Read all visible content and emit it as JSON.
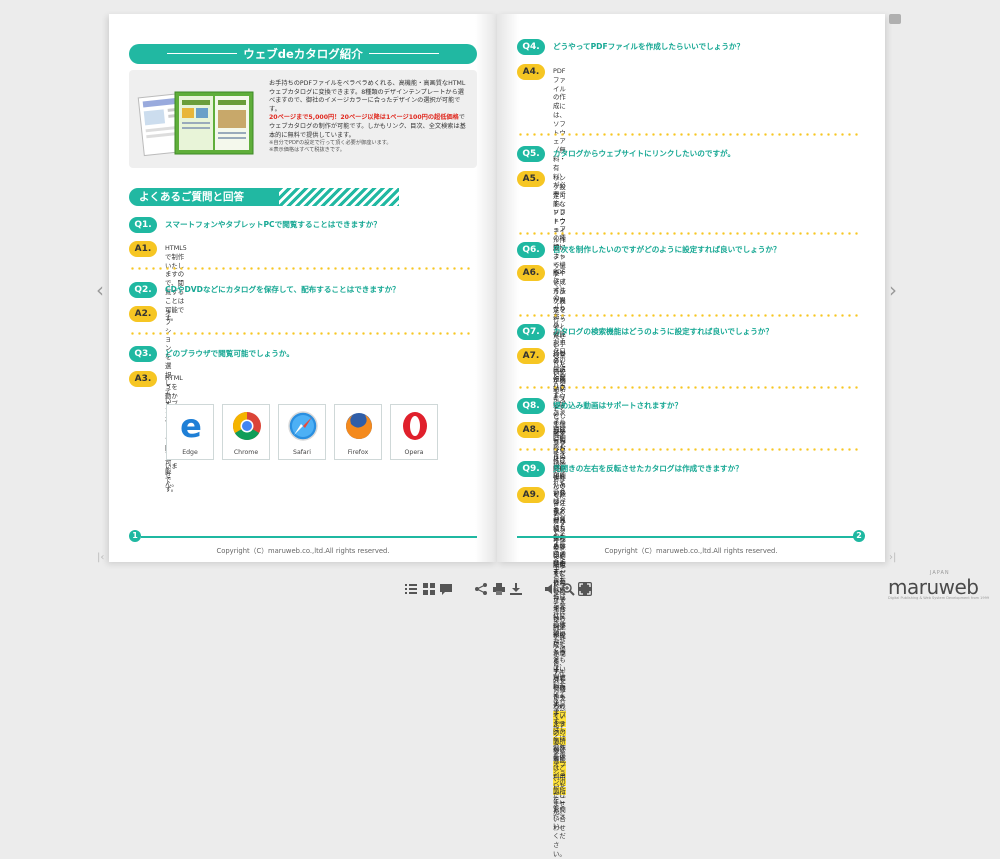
{
  "left_page": {
    "title": "ウェブdeカタログ紹介",
    "intro": {
      "line1": "お手持ちのPDFファイルをペラペラめくれる、高機能・高画質なHTMLウェブカタログに変換できます。8種類のデザインテンプレートから選べますので、御社のイメージカラーに合ったデザインの選択が可能です。",
      "red": "20ページまで5,000円！20ページ以降は1ページ100円の超低価格",
      "line2": "でウェブカタログの制作が可能です。しかもリンク、目次、全文検索は基本的に無料で提供しています。",
      "note1": "※自分でPDFの設定で行って頂く必要が御座います。",
      "note2": "※表示価格はすべて税抜きです。"
    },
    "faq_title": "よくあるご質問と回答",
    "qa": [
      {
        "q_label": "Q1.",
        "q": "スマートフォンやタブレットPCで閲覧することはできますか？",
        "a_label": "A1.",
        "a": "HTML5で制作いたしますので、閲覧することは可能です。"
      },
      {
        "q_label": "Q2.",
        "q": "CDやDVDなどにカタログを保存して、配布することはできますか？",
        "a_label": "A2.",
        "a": "オプションを選択していただくことで可能です。"
      },
      {
        "q_label": "Q3.",
        "q": "どのブラウザで閲覧可能でしょうか。",
        "a_label": "A3.",
        "a": "HTML５を動かすブラウザなら何でも問題ございません。"
      }
    ],
    "browsers": [
      "Edge",
      "Chrome",
      "Safari",
      "Firefox",
      "Opera"
    ],
    "page_number": "1",
    "copyright": "Copyright（C）maruweb.co.,ltd.All rights reserved."
  },
  "right_page": {
    "qa": [
      {
        "q_label": "Q4.",
        "q": "どうやってPDFファイルを作成したらいいでしょうか？",
        "a_label": "A4.",
        "a_lines": [
          "PDFファイルの作成には、ソフトウェア（無料・有料）が必要です。ソフトウェアの種",
          "類によって機能や作成方法が異なりますので、お手持ちのPDF作成ソフトウェアのヘル",
          "プをご覧ください。",
          "印刷したカタログをお持ちでしたら、印刷時のデータをPDFファイルに変換するのが、",
          "もっともよいと思われます。印刷物のカタログ制作を依頼した業者さまに、お問い合",
          "わせください。"
        ]
      },
      {
        "q_label": "Q5.",
        "q": "カタログからウェブサイトにリンクしたいのですが。",
        "a_label": "A5.",
        "a_lines": [
          "リンク設定可能なＰＤＦファイル作成ソフトウェアで、リンク設定を行ってください",
          "。ＵＲＬ表記が自動的にリンクとして機能するわけではございませんので、ご注意く",
          "ださい。",
          "弊社にリンク設定をご依頼いただく場合は、別途料金にて承ります。"
        ],
        "a_last_pre": "詳しくはこちらの",
        "a_link": "オプションの箇所",
        "a_last_post": "をご覧ください。"
      },
      {
        "q_label": "Q6.",
        "q": "目次を制作したいのですがどのように設定すれば良いでしょうか？",
        "a_label": "A6.",
        "a_lines": [
          "PDFファイルの「しおり」機能がカタログの目次になります。PDFファイル作成時に",
          "しおりの設定がされていれば、カタログにそのまま反映されます。",
          "しおりの作成を弊社にご依頼いただく場合は、別途料金にて承ります。"
        ],
        "a_last_pre": "詳しくはこちらの",
        "a_link": "オプションの箇所",
        "a_last_post": "をご覧ください。"
      },
      {
        "q_label": "Q7.",
        "q": "カタログの検索機能はどうのように設定すれば良いでしょうか？",
        "a_label": "A7.",
        "a_lines": [
          "検索したい文字列をテキストとして、PDFファイル作成時に保存してください。アウ",
          "トラインをとったイラストレーターファイルからPDFを作成した場合、テキスト情報",
          "が失われていますので、検索機能はご利用いただけません。"
        ]
      },
      {
        "q_label": "Q8.",
        "q": "埋め込み動画はサポートされますか？",
        "a_label": "A8.",
        "a_lines": [
          "別途ご相談ください。"
        ]
      },
      {
        "q_label": "Q9.",
        "q": "見開きの左右を反転させたカタログは作成できますか？",
        "a_label": "A9.",
        "a_lines": [
          "可能です。お見積り依頼の際にご選択ください。"
        ]
      }
    ],
    "page_number": "2",
    "copyright": "Copyright（C）maruweb.co.,ltd.All rights reserved."
  },
  "logo": {
    "small": "JAPAN",
    "main": "maruweb",
    "sub": "Digital Publishing & Web System Development from 1999"
  },
  "colors": {
    "teal": "#1fb8a1",
    "yellow": "#f6c623",
    "highlight": "#ffe23a",
    "red": "#e0281e"
  }
}
